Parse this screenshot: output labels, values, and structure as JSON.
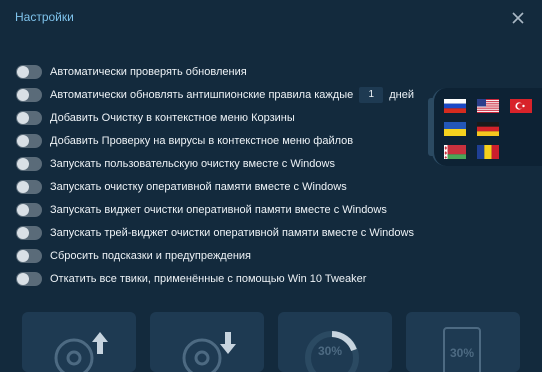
{
  "window": {
    "title": "Настройки"
  },
  "options": [
    {
      "label": "Автоматически проверять обновления",
      "enabled": false
    },
    {
      "label_before": "Автоматически обновлять антишпионские правила каждые",
      "interval_value": "1",
      "label_after": "дней",
      "enabled": false
    },
    {
      "label": "Добавить Очистку в контекстное меню Корзины",
      "enabled": false
    },
    {
      "label": "Добавить Проверку на вирусы в контекстное меню файлов",
      "enabled": false
    },
    {
      "label": "Запускать пользовательскую очистку вместе с Windows",
      "enabled": false
    },
    {
      "label": "Запускать очистку оперативной памяти вместе с Windows",
      "enabled": false
    },
    {
      "label": "Запускать виджет очистки оперативной памяти вместе с Windows",
      "enabled": false
    },
    {
      "label": "Запускать трей-виджет очистки оперативной памяти вместе с Windows",
      "enabled": false
    },
    {
      "label": "Сбросить подсказки и предупреждения",
      "enabled": false
    },
    {
      "label": "Откатить все твики, применённые с помощью Win 10 Tweaker",
      "enabled": false
    }
  ],
  "languages": [
    {
      "name": "russian-flag"
    },
    {
      "name": "usa-flag"
    },
    {
      "name": "turkey-flag"
    },
    {
      "name": "ukraine-flag"
    },
    {
      "name": "germany-flag"
    },
    {
      "name": "belarus-flag"
    },
    {
      "name": "romania-flag"
    }
  ],
  "tiles": {
    "tile3_percent": "30%",
    "tile4_percent": "30%"
  },
  "colors": {
    "background": "#132a3d",
    "title": "#7fc3ec",
    "toggle_off": "#5a6b79",
    "tile": "#1e3a52"
  }
}
